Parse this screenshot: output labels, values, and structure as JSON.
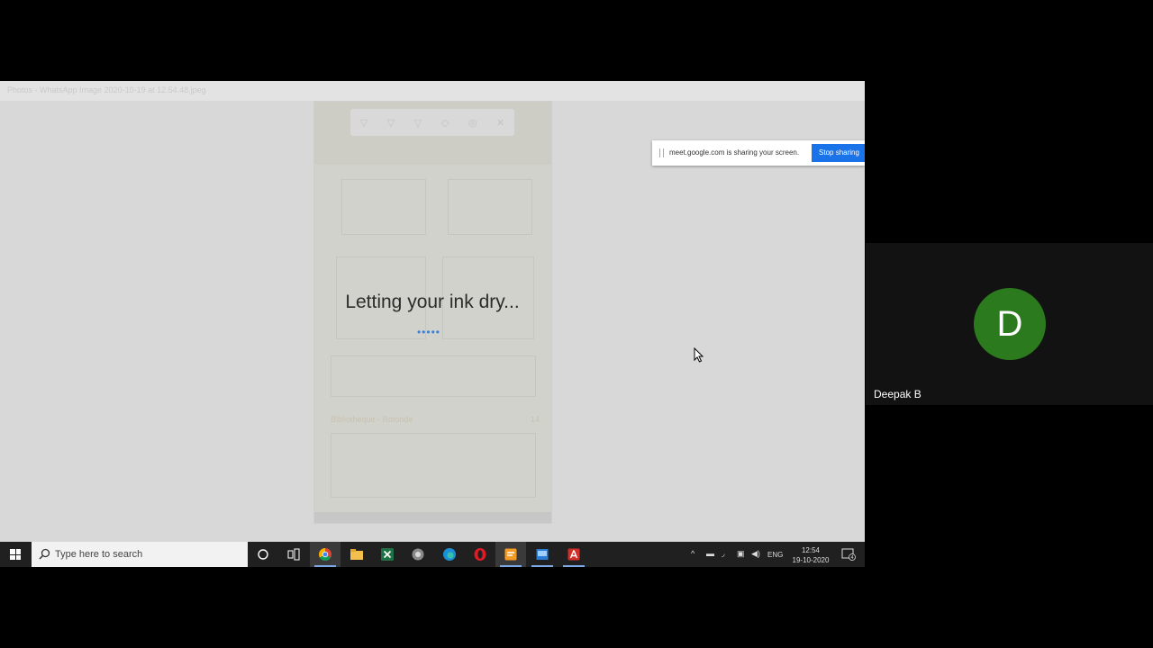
{
  "shared_screen": {
    "window_title": "Photos - WhatsApp Image 2020-10-19 at 12.54.48.jpeg",
    "overlay_message": "Letting your ink dry...",
    "loading_dots": "•••••",
    "doc_caption": "Bibliotheque - Rotonde",
    "doc_page": "14"
  },
  "share_banner": {
    "message": "meet.google.com is sharing your screen.",
    "stop_label": "Stop sharing",
    "button_color": "#1a73e8"
  },
  "taskbar": {
    "search_placeholder": "Type here to search",
    "apps": [
      "cortana-icon",
      "task-view-icon",
      "chrome-icon",
      "file-explorer-icon",
      "excel-icon",
      "app-icon",
      "edge-icon",
      "opera-icon",
      "sticky-app-icon",
      "paint-icon",
      "acrobat-icon"
    ],
    "tray": {
      "language": "ENG",
      "time": "12:54",
      "date": "19-10-2020",
      "notification_count": "4"
    }
  },
  "participant": {
    "initial": "D",
    "name": "Deepak B",
    "avatar_color": "#2b7a1e"
  }
}
